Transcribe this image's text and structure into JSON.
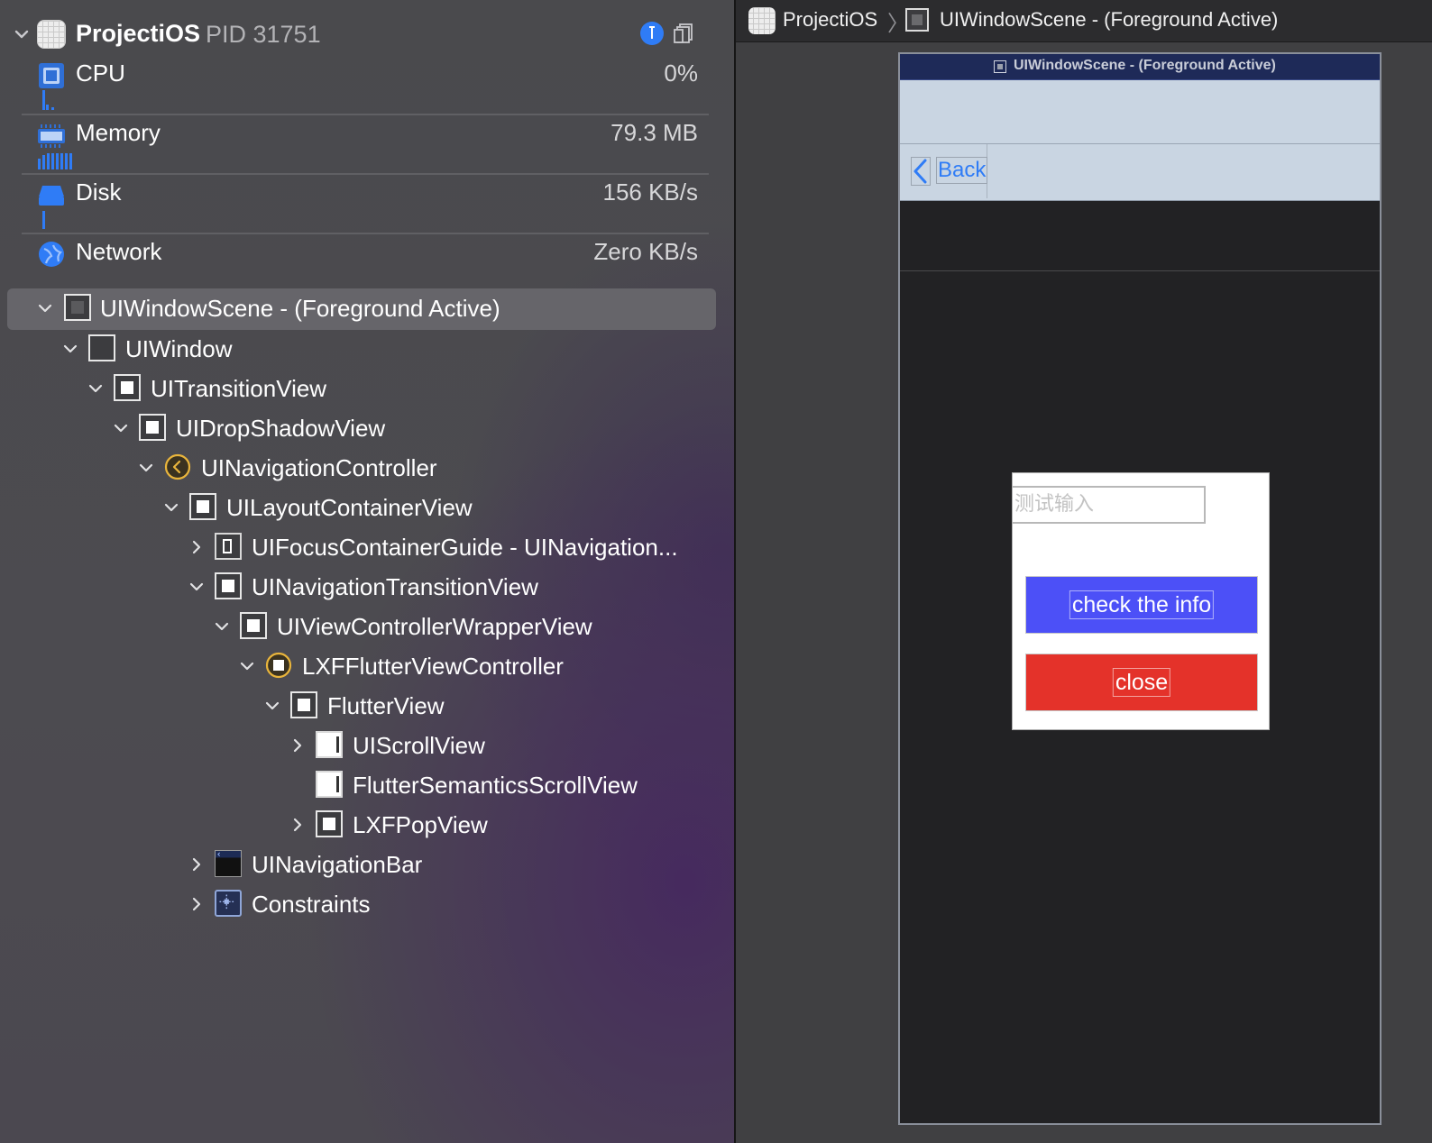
{
  "process": {
    "name": "ProjectiOS",
    "pid_label": "PID 31751"
  },
  "gauges": [
    {
      "label": "CPU",
      "value": "0%",
      "icon": "cpu-icon"
    },
    {
      "label": "Memory",
      "value": "79.3 MB",
      "icon": "memory-icon"
    },
    {
      "label": "Disk",
      "value": "156 KB/s",
      "icon": "disk-icon"
    },
    {
      "label": "Network",
      "value": "Zero KB/s",
      "icon": "network-icon"
    }
  ],
  "tree": [
    {
      "label": "UIWindowScene - (Foreground Active)",
      "expanded": true,
      "selected": true,
      "icon": "scene-icon"
    },
    {
      "label": "UIWindow",
      "expanded": true,
      "icon": "window-icon"
    },
    {
      "label": "UITransitionView",
      "expanded": true,
      "icon": "view-icon"
    },
    {
      "label": "UIDropShadowView",
      "expanded": true,
      "icon": "view-icon"
    },
    {
      "label": "UINavigationController",
      "expanded": true,
      "icon": "controller-icon"
    },
    {
      "label": "UILayoutContainerView",
      "expanded": true,
      "icon": "view-icon"
    },
    {
      "label": "UIFocusContainerGuide - UINavigation...",
      "expanded": false,
      "icon": "guide-icon"
    },
    {
      "label": "UINavigationTransitionView",
      "expanded": true,
      "icon": "view-icon"
    },
    {
      "label": "UIViewControllerWrapperView",
      "expanded": true,
      "icon": "view-icon"
    },
    {
      "label": "LXFFlutterViewController",
      "expanded": true,
      "icon": "controller-icon"
    },
    {
      "label": "FlutterView",
      "expanded": true,
      "icon": "view-icon"
    },
    {
      "label": "UIScrollView",
      "expanded": false,
      "icon": "scrollview-icon"
    },
    {
      "label": "FlutterSemanticsScrollView",
      "expanded": null,
      "icon": "scrollview-icon"
    },
    {
      "label": "LXFPopView",
      "expanded": false,
      "icon": "view-icon"
    },
    {
      "label": "UINavigationBar",
      "expanded": false,
      "icon": "navbar-icon"
    },
    {
      "label": "Constraints",
      "expanded": false,
      "icon": "constraints-icon"
    }
  ],
  "jumpbar": {
    "app": "ProjectiOS",
    "scene": "UIWindowScene - (Foreground Active)"
  },
  "scene": {
    "title": "UIWindowScene - (Foreground Active)",
    "back_label": "Back",
    "input_placeholder": "测试输入",
    "check_button": "check the info",
    "close_button": "close"
  },
  "colors": {
    "accent": "#2f7cf6",
    "check_button": "#4c50f7",
    "close_button": "#e4322a",
    "controller_icon": "#e9b53c"
  }
}
